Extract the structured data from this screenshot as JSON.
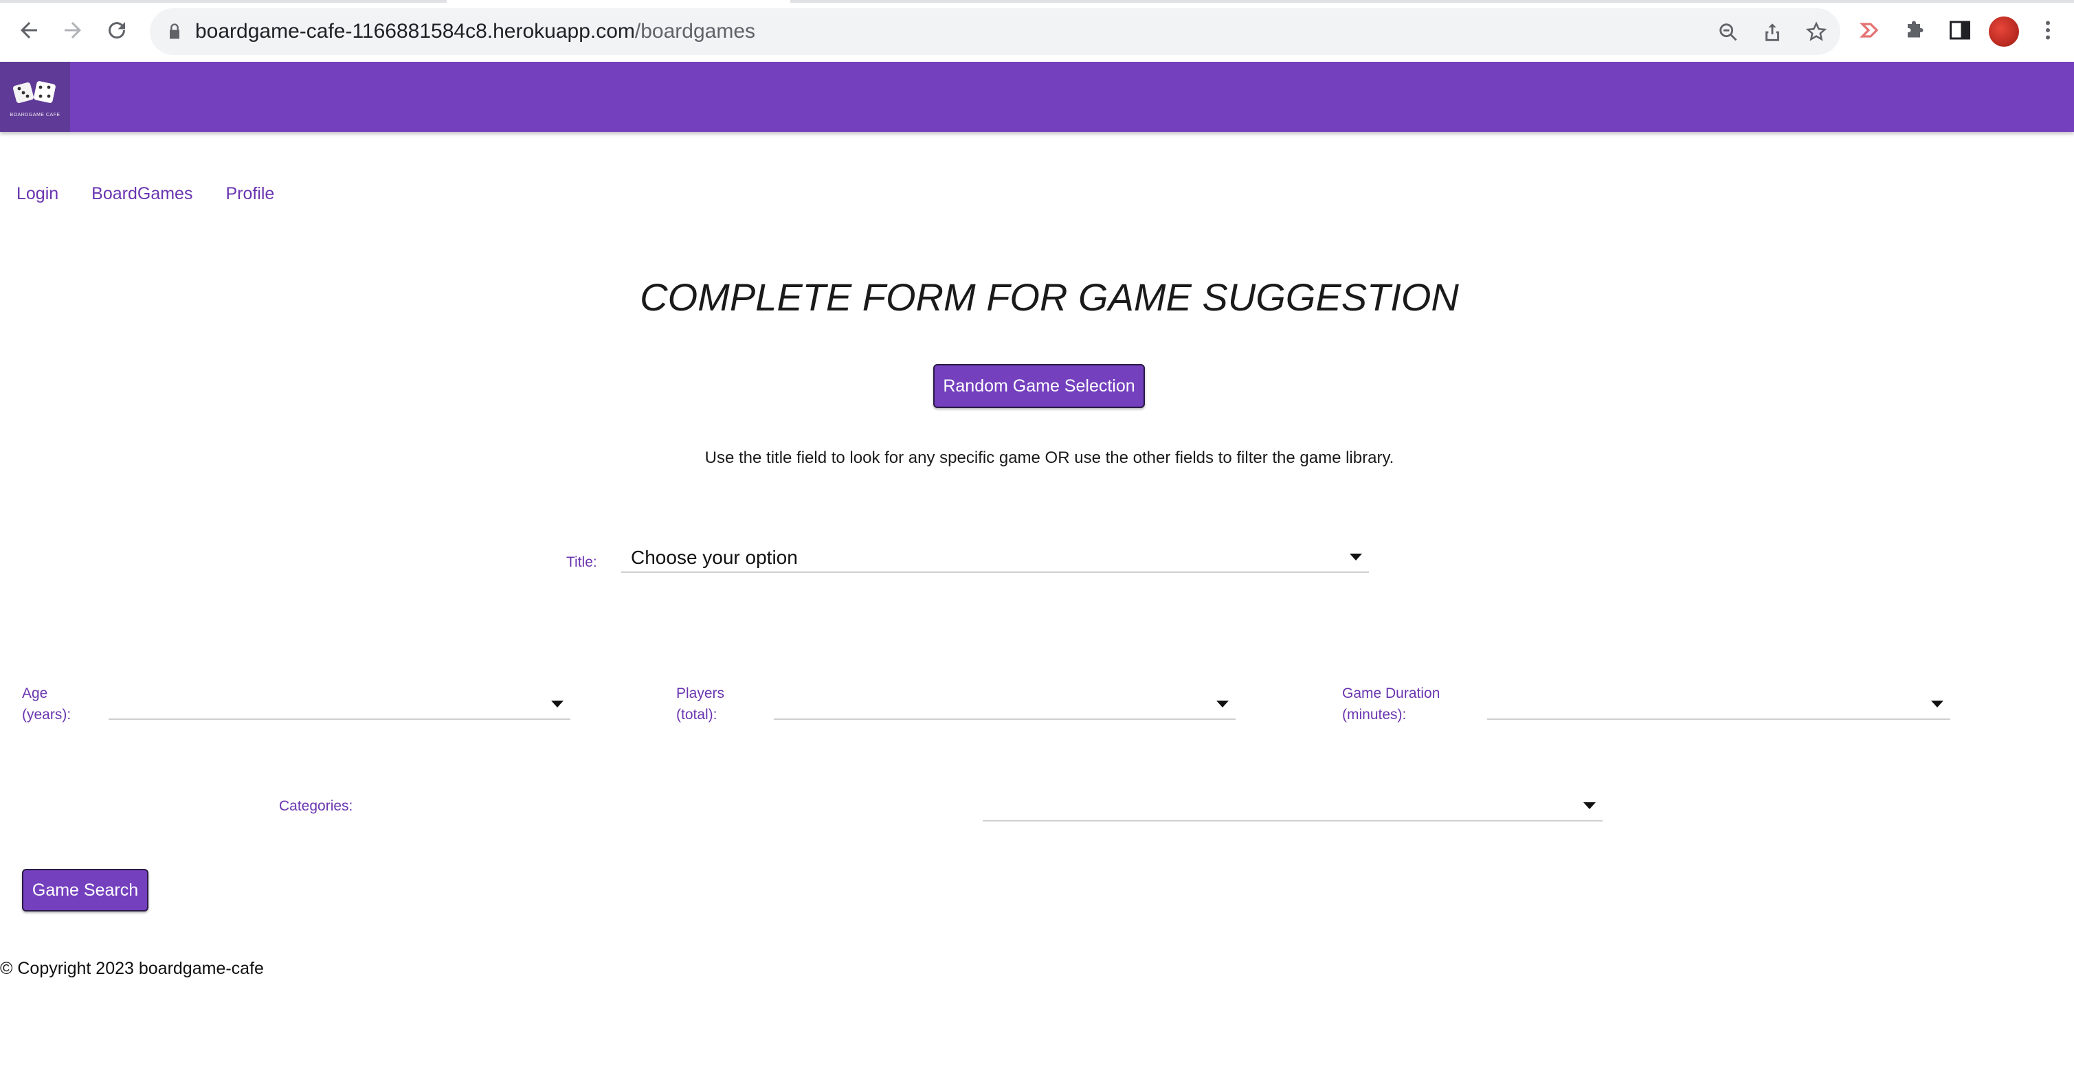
{
  "browser": {
    "url_host": "boardgame-cafe-1166881584c8.herokuapp.com",
    "url_path": "/boardgames"
  },
  "header": {
    "logo_text": "BOARDGAME CAFE"
  },
  "nav": {
    "links": [
      "Login",
      "BoardGames",
      "Profile"
    ]
  },
  "main": {
    "title": "COMPLETE FORM FOR GAME SUGGESTION",
    "random_button": "Random Game Selection",
    "instructions": "Use the title field to look for any specific game OR use the other fields to filter the game library.",
    "title_field": {
      "label": "Title:",
      "value": "Choose your option"
    },
    "age_field": {
      "label_line1": "Age",
      "label_line2": "(years):",
      "value": ""
    },
    "players_field": {
      "label_line1": "Players",
      "label_line2": "(total):",
      "value": ""
    },
    "duration_field": {
      "label_line1": "Game Duration",
      "label_line2": "(minutes):",
      "value": ""
    },
    "categories_field": {
      "label": "Categories:",
      "value": ""
    },
    "search_button": "Game Search"
  },
  "footer": {
    "copyright": "© Copyright 2023 boardgame-cafe"
  },
  "colors": {
    "brand": "#7440be",
    "link": "#6a35b0"
  }
}
